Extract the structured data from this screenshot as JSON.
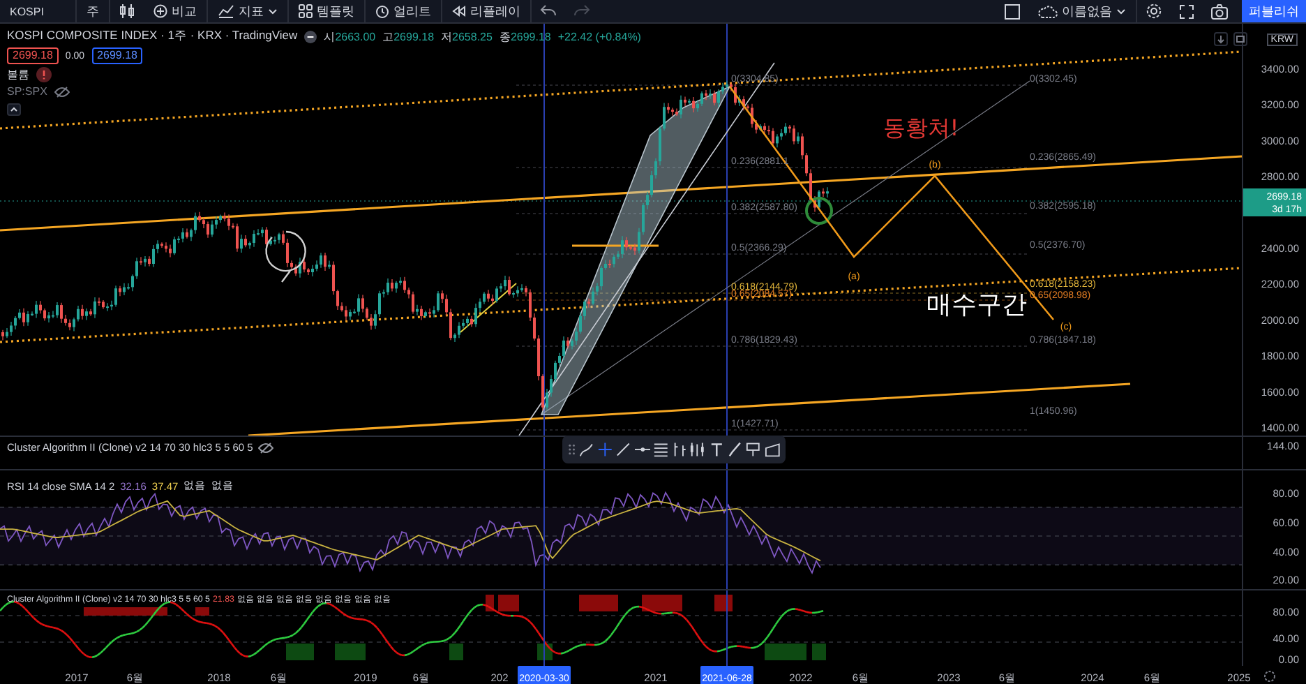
{
  "toolbar": {
    "symbol": "KOSPI",
    "interval": "주",
    "items": [
      {
        "kind": "compare",
        "label": "비교"
      },
      {
        "kind": "indicators",
        "label": "지표"
      },
      {
        "kind": "templates",
        "label": "템플릿"
      },
      {
        "kind": "alert",
        "label": "얼리트"
      },
      {
        "kind": "replay",
        "label": "리플레이"
      }
    ],
    "layout_name": "이름없음",
    "publish": "퍼블리쉬"
  },
  "legend": {
    "title": "KOSPI COMPOSITE INDEX · 1주 · KRX · TradingView",
    "ohlc": [
      {
        "label": "시",
        "value": "2663.00"
      },
      {
        "label": "고",
        "value": "2699.18"
      },
      {
        "label": "저",
        "value": "2658.25"
      },
      {
        "label": "종",
        "value": "2699.18"
      }
    ],
    "change": "+22.42 (+0.84%)",
    "bid": "2699.18",
    "spread": "0.00",
    "ask": "2699.18",
    "studies": [
      {
        "name": "볼륨",
        "kind": "error"
      },
      {
        "name": "SP:SPX",
        "kind": "hidden"
      }
    ]
  },
  "price_axis": {
    "currency": "KRW",
    "labels": [
      "3400.00",
      "3200.00",
      "3000.00",
      "2800.00",
      "2400.00",
      "2200.00",
      "2000.00",
      "1800.00",
      "1600.00",
      "1400.00"
    ],
    "last_price": "2699.18",
    "countdown": "3d 17h"
  },
  "drawings": {
    "fib_left": [
      {
        "text": "0(3304.85)",
        "color": "#787b86"
      },
      {
        "text": "0.236(2881.1",
        "color": "#787b86"
      },
      {
        "text": "0.382(2587.80)",
        "color": "#787b86"
      },
      {
        "text": "0.5(2366.29)",
        "color": "#787b86"
      },
      {
        "text": "0.618(2144.79)",
        "color": "#e0b43a"
      },
      {
        "text": "0.65(2084.57)",
        "color": "#e07b22"
      },
      {
        "text": "0.786(1829.43)",
        "color": "#787b86"
      },
      {
        "text": "1(1427.71)",
        "color": "#787b86"
      }
    ],
    "fib_right": [
      {
        "text": "0(3302.45)",
        "color": "#787b86"
      },
      {
        "text": "0.236(2865.49)",
        "color": "#787b86"
      },
      {
        "text": "0.382(2595.18)",
        "color": "#787b86"
      },
      {
        "text": "0.5(2376.70)",
        "color": "#787b86"
      },
      {
        "text": "0.618(2158.23)",
        "color": "#e0b43a"
      },
      {
        "text": "0.65(2098.98)",
        "color": "#e07b22"
      },
      {
        "text": "0.786(1847.18)",
        "color": "#787b86"
      },
      {
        "text": "1(1450.96)",
        "color": "#787b86"
      }
    ],
    "waves": [
      "(a)",
      "(b)",
      "(c)"
    ],
    "notes": [
      {
        "text": "동황쳐!",
        "color": "#e53935"
      },
      {
        "text": "매수구간",
        "color": "#ffffff"
      }
    ]
  },
  "panes": [
    {
      "kind": "collapsed",
      "title": "Cluster Algorithm II (Clone) v2 14 70 30 hlc3 5 5 60 5",
      "hidden": true,
      "axis": [
        "144.00"
      ]
    },
    {
      "kind": "rsi",
      "title": "RSI 14 close SMA 14 2",
      "values": [
        {
          "text": "32.16",
          "color": "#9575cd"
        },
        {
          "text": "37.47",
          "color": "#f0d050"
        },
        {
          "text": "없음",
          "color": "#d1d4dc"
        },
        {
          "text": "없음",
          "color": "#d1d4dc"
        }
      ],
      "axis": [
        "80.00",
        "60.00",
        "40.00",
        "20.00"
      ]
    },
    {
      "kind": "cluster",
      "title": "Cluster Algorithm II (Clone) v2 14 70 30 hlc3 5 5 60 5",
      "values": [
        {
          "text": "21.83",
          "color": "#ef5350"
        },
        {
          "text": "없음",
          "color": "#d1d4dc"
        },
        {
          "text": "없음",
          "color": "#d1d4dc"
        },
        {
          "text": "없음",
          "color": "#d1d4dc"
        },
        {
          "text": "없음",
          "color": "#d1d4dc"
        },
        {
          "text": "없음",
          "color": "#d1d4dc"
        },
        {
          "text": "없음",
          "color": "#d1d4dc"
        },
        {
          "text": "없음",
          "color": "#d1d4dc"
        },
        {
          "text": "없음",
          "color": "#d1d4dc"
        }
      ],
      "axis": [
        "80.00",
        "40.00",
        "0.00"
      ]
    }
  ],
  "time_axis": {
    "labels": [
      "2017",
      "6월",
      "2018",
      "6월",
      "2019",
      "6월",
      "202",
      "2021",
      "2022",
      "6월",
      "2023",
      "6월",
      "2024",
      "6월",
      "2025"
    ],
    "markers": [
      "2020-03-30",
      "2021-06-28"
    ]
  }
}
